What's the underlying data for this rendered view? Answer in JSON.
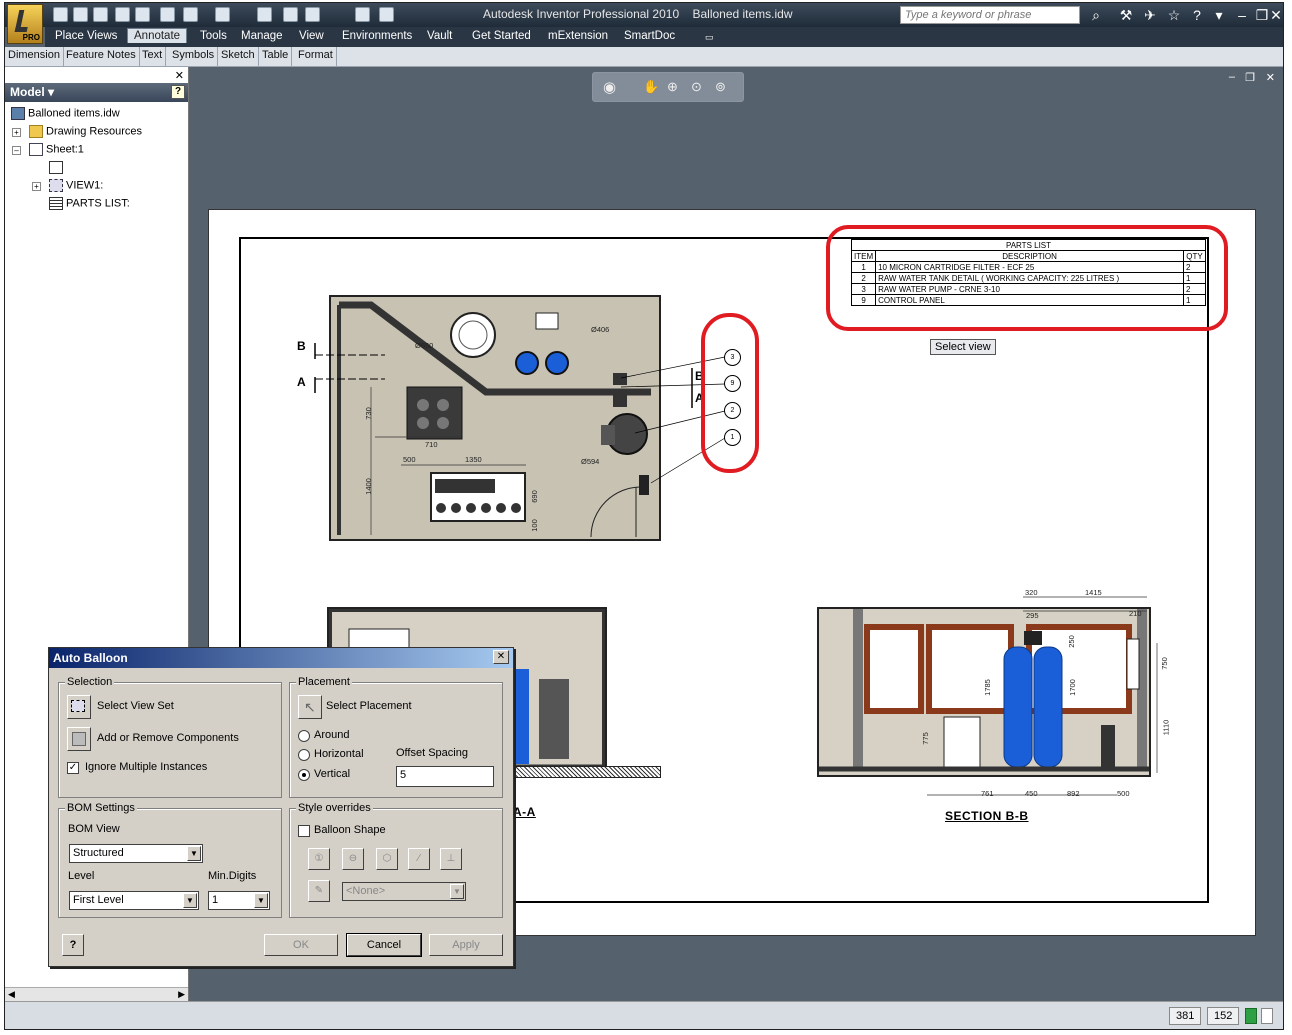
{
  "app": {
    "title": "Autodesk Inventor Professional 2010",
    "document": "Balloned items.idw",
    "search_placeholder": "Type a keyword or phrase",
    "edition_badge": "PRO"
  },
  "menu": {
    "tabs": [
      "Place Views",
      "Annotate",
      "Tools",
      "Manage",
      "View",
      "Environments",
      "Vault",
      "Get Started",
      "mExtension",
      "SmartDoc"
    ],
    "active": "Annotate"
  },
  "panels": [
    "Dimension",
    "Feature Notes",
    "Text",
    "Symbols",
    "Sketch",
    "Table",
    "Format"
  ],
  "browser": {
    "header": "Model",
    "tree": {
      "root": "Balloned items.idw",
      "resources": "Drawing Resources",
      "sheet": "Sheet:1",
      "view": "VIEW1:",
      "parts_list": "PARTS LIST:"
    }
  },
  "parts_list": {
    "title": "PARTS LIST",
    "headers": [
      "ITEM",
      "DESCRIPTION",
      "QTY"
    ],
    "rows": [
      [
        "1",
        "10 MICRON CARTRIDGE FILTER - ECF 25",
        "2"
      ],
      [
        "2",
        "RAW WATER TANK DETAIL ( WORKING CAPACITY: 225 LITRES )",
        "1"
      ],
      [
        "3",
        "RAW WATER PUMP - CRNE 3-10",
        "2"
      ],
      [
        "9",
        "CONTROL PANEL",
        "1"
      ]
    ]
  },
  "drawing": {
    "select_view_tooltip": "Select view",
    "balloons": [
      "3",
      "9",
      "2",
      "1"
    ],
    "section_markers": {
      "b": "B",
      "a": "A"
    },
    "plan_dims": [
      "Ø650",
      "Ø406",
      "730",
      "710",
      "500",
      "1350",
      "1400",
      "Ø594",
      "690",
      "100"
    ],
    "section_aa_label": "A-A",
    "section_bb_label": "SECTION B-B",
    "section_bb_dims": [
      "320",
      "1415",
      "295",
      "210",
      "250",
      "750",
      "1785",
      "1700",
      "1110",
      "775",
      "761",
      "450",
      "892",
      "500"
    ]
  },
  "dialog": {
    "title": "Auto Balloon",
    "selection": {
      "group": "Selection",
      "select_view_set": "Select View Set",
      "add_remove": "Add or Remove Components",
      "ignore_multiple": "Ignore Multiple Instances",
      "ignore_multiple_checked": true
    },
    "placement": {
      "group": "Placement",
      "select_placement": "Select Placement",
      "around": "Around",
      "horizontal": "Horizontal",
      "vertical": "Vertical",
      "selected": "Vertical",
      "offset_label": "Offset Spacing",
      "offset_value": "5"
    },
    "bom": {
      "group": "BOM Settings",
      "view_label": "BOM View",
      "view_value": "Structured",
      "level_label": "Level",
      "level_value": "First Level",
      "min_digits_label": "Min.Digits",
      "min_digits_value": "1"
    },
    "style": {
      "group": "Style overrides",
      "balloon_shape": "Balloon Shape",
      "balloon_shape_checked": false,
      "style_value": "<None>"
    },
    "buttons": {
      "ok": "OK",
      "cancel": "Cancel",
      "apply": "Apply"
    }
  },
  "status": {
    "x": "381",
    "y": "152"
  },
  "colors": {
    "highlight_red": "#e01b22",
    "dialog_title": "#0a246a",
    "tank_blue": "#1a5fd8"
  }
}
